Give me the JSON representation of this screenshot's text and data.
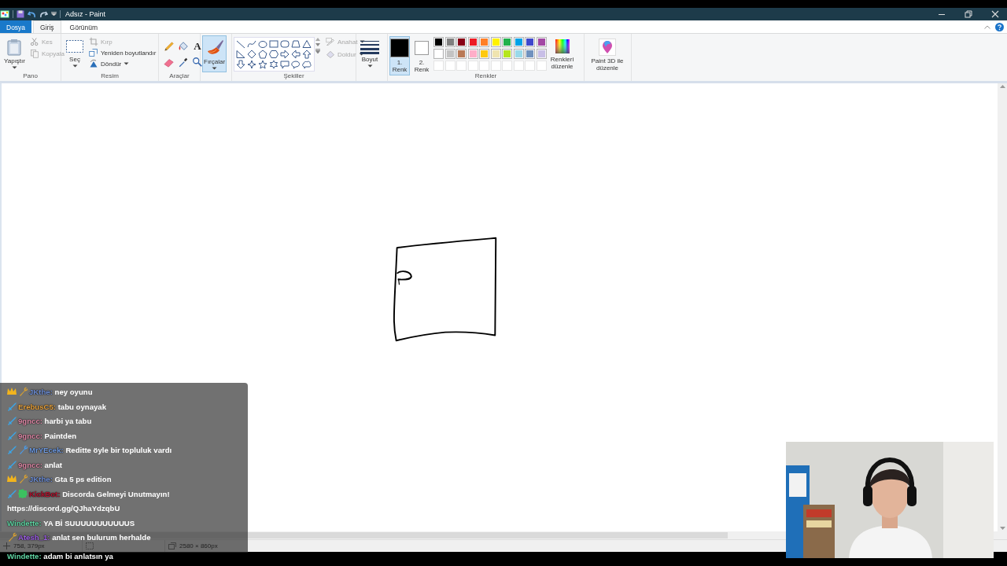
{
  "window": {
    "title": "Adsız - Paint"
  },
  "tabs": [
    {
      "label": "Dosya",
      "kind": "file",
      "selected": false
    },
    {
      "label": "Giriş",
      "kind": "tab",
      "selected": true
    },
    {
      "label": "Görünüm",
      "kind": "tab",
      "selected": false
    }
  ],
  "ribbon": {
    "clipboard": {
      "label": "Pano",
      "paste": {
        "label": "Yapıştır",
        "dropdown": true
      },
      "actions": [
        {
          "label": "Kes",
          "kind": "scissors",
          "disabled": true,
          "dropdown": false
        },
        {
          "label": "Kopyala",
          "kind": "copy",
          "disabled": true,
          "dropdown": false
        }
      ]
    },
    "image": {
      "label": "Resim",
      "select": {
        "label": "Seç",
        "dropdown": true
      },
      "actions": [
        {
          "label": "Kırp",
          "kind": "crop",
          "disabled": true,
          "dropdown": false
        },
        {
          "label": "Yeniden boyutlandır",
          "kind": "resize",
          "disabled": false,
          "dropdown": false
        },
        {
          "label": "Döndür",
          "kind": "rotate",
          "disabled": false,
          "dropdown": true
        }
      ]
    },
    "tools": {
      "label": "Araçlar",
      "items": [
        {
          "kind": "pencil"
        },
        {
          "kind": "bucket"
        },
        {
          "kind": "text",
          "glyph": "A"
        },
        {
          "kind": "eraser"
        },
        {
          "kind": "picker"
        },
        {
          "kind": "magnifier"
        }
      ]
    },
    "brushes": {
      "label": "Fırçalar",
      "selected": true,
      "dropdown": true
    },
    "shapes": {
      "label": "Şekiller",
      "items": [
        {
          "kind": "line"
        },
        {
          "kind": "curve"
        },
        {
          "kind": "oval"
        },
        {
          "kind": "rect"
        },
        {
          "kind": "roundrect"
        },
        {
          "kind": "polygon"
        },
        {
          "kind": "triangle"
        },
        {
          "kind": "righttriangle"
        },
        {
          "kind": "diamond"
        },
        {
          "kind": "pentagon"
        },
        {
          "kind": "hexagon"
        },
        {
          "kind": "arrowright"
        },
        {
          "kind": "arrowleft"
        },
        {
          "kind": "arrowup"
        },
        {
          "kind": "arrowdown"
        },
        {
          "kind": "star4"
        },
        {
          "kind": "star5"
        },
        {
          "kind": "star6"
        },
        {
          "kind": "calloutrect"
        },
        {
          "kind": "calloutoval"
        },
        {
          "kind": "calloutcloud"
        }
      ],
      "outline": {
        "label": "Anahat",
        "disabled": true,
        "dropdown": true
      },
      "fill": {
        "label": "Doldur",
        "disabled": true,
        "dropdown": true
      }
    },
    "size": {
      "label": "Boyut",
      "dropdown": true
    },
    "colors": {
      "label": "Renkler",
      "color1": {
        "label": "1. Renk",
        "color": "#000000",
        "selected": true
      },
      "color2": {
        "label": "2. Renk",
        "color": "#ffffff",
        "selected": false
      },
      "palette": [
        [
          {
            "kind": "color",
            "color": "#000000"
          },
          {
            "kind": "color",
            "color": "#7f7f7f"
          },
          {
            "kind": "color",
            "color": "#880015"
          },
          {
            "kind": "color",
            "color": "#ed1c24"
          },
          {
            "kind": "color",
            "color": "#ff7f27"
          },
          {
            "kind": "color",
            "color": "#fff200"
          },
          {
            "kind": "color",
            "color": "#22b14c"
          },
          {
            "kind": "color",
            "color": "#00a2e8"
          },
          {
            "kind": "color",
            "color": "#3f48cc"
          },
          {
            "kind": "color",
            "color": "#a349a4"
          }
        ],
        [
          {
            "kind": "color",
            "color": "#ffffff"
          },
          {
            "kind": "color",
            "color": "#c3c3c3"
          },
          {
            "kind": "color",
            "color": "#b97a57"
          },
          {
            "kind": "color",
            "color": "#ffaec9"
          },
          {
            "kind": "color",
            "color": "#ffc90e"
          },
          {
            "kind": "color",
            "color": "#efe4b0"
          },
          {
            "kind": "color",
            "color": "#b5e61d"
          },
          {
            "kind": "color",
            "color": "#99d9ea"
          },
          {
            "kind": "color",
            "color": "#7092be"
          },
          {
            "kind": "color",
            "color": "#c8bfe7"
          }
        ],
        [
          {
            "kind": "empty"
          },
          {
            "kind": "empty"
          },
          {
            "kind": "empty"
          },
          {
            "kind": "empty"
          },
          {
            "kind": "empty"
          },
          {
            "kind": "empty"
          },
          {
            "kind": "empty"
          },
          {
            "kind": "empty"
          },
          {
            "kind": "empty"
          },
          {
            "kind": "empty"
          }
        ]
      ],
      "edit": {
        "label": "Renkleri düzenle"
      }
    },
    "paint3d": {
      "label": "Paint 3D ile düzenle"
    }
  },
  "status_bar": {
    "cursor": "758, 379px",
    "canvas_size": "2580 × 860px"
  },
  "chat": {
    "messages": [
      {
        "badges": [
          {
            "kind": "crown"
          },
          {
            "kind": "tool"
          }
        ],
        "user": "JKthe:",
        "color": "#6f8fd6",
        "text": "ney oyunu"
      },
      {
        "badges": [
          {
            "kind": "sword"
          }
        ],
        "user": "ErebusC5:",
        "color": "#e8a23c",
        "text": "tabu oynayak"
      },
      {
        "badges": [
          {
            "kind": "sword"
          }
        ],
        "user": "9gncc:",
        "color": "#e08aa8",
        "text": "harbi ya tabu"
      },
      {
        "badges": [
          {
            "kind": "sword"
          }
        ],
        "user": "9gncc:",
        "color": "#e08aa8",
        "text": "Paintden"
      },
      {
        "badges": [
          {
            "kind": "sword"
          },
          {
            "kind": "tool-blue"
          }
        ],
        "user": "MrYEcek:",
        "color": "#6f9ae0",
        "text": "Reditte öyle bir topluluk vardı"
      },
      {
        "badges": [
          {
            "kind": "sword"
          }
        ],
        "user": "9gncc:",
        "color": "#e08aa8",
        "text": "anlat"
      },
      {
        "badges": [
          {
            "kind": "crown"
          },
          {
            "kind": "tool"
          }
        ],
        "user": "JKthe:",
        "color": "#6f8fd6",
        "text": "Gta 5 ps edition"
      },
      {
        "badges": [
          {
            "kind": "sword"
          },
          {
            "kind": "verified"
          }
        ],
        "user": "KickBot:",
        "color": "#b3122e",
        "text": "Discorda Gelmeyi Unutmayın!",
        "link": "https://discord.gg/QJhaYdzqbU"
      },
      {
        "user": "Windette:",
        "color": "#5fd6a4",
        "text": "YA Bİ SUUUUUUUUUUUS"
      },
      {
        "badges": [
          {
            "kind": "tool"
          }
        ],
        "user": "Atesh_1:",
        "color": "#a060e8",
        "text": "anlat sen bulurum herhalde"
      },
      {
        "user": "Windette:",
        "color": "#5fd6a4",
        "text": "adam bi anlatsın ya"
      }
    ]
  }
}
